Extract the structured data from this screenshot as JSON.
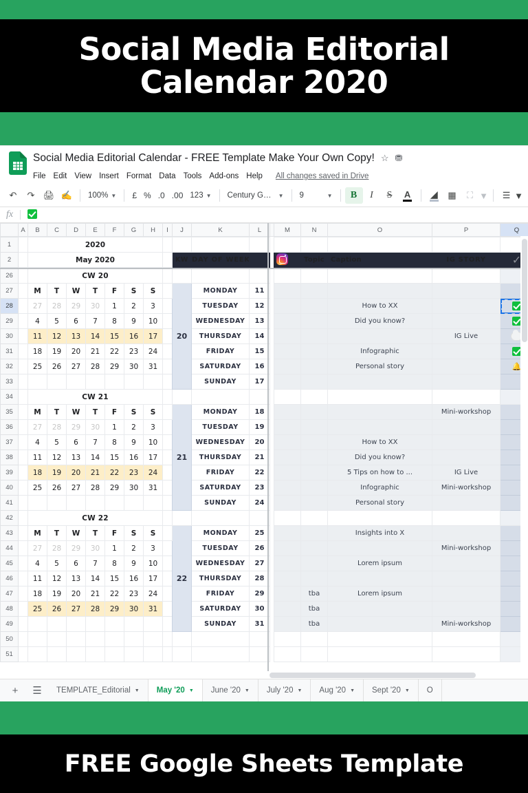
{
  "pin": {
    "top_title_line1": "Social Media Editorial",
    "top_title_line2": "Calendar 2020",
    "bottom_title": "FREE Google Sheets Template",
    "brand_green": "#28a35f",
    "banner_black": "#000000"
  },
  "app": {
    "doc_title": "Social Media Editorial Calendar - FREE Template Make Your Own Copy!",
    "star_icon": "star-icon",
    "drive_icon": "move-to-drive-icon",
    "menus": [
      "File",
      "Edit",
      "View",
      "Insert",
      "Format",
      "Data",
      "Tools",
      "Add-ons",
      "Help"
    ],
    "save_status": "All changes saved in Drive"
  },
  "toolbar": {
    "undo_icon": "undo-icon",
    "redo_icon": "redo-icon",
    "print_icon": "print-icon",
    "paint_format_icon": "paint-format-icon",
    "zoom_value": "100%",
    "currency_label": "£",
    "percent_label": "%",
    "dec_decrease_label": ".0",
    "dec_increase_label": ".00",
    "format_label": "123",
    "font_name": "Century Go...",
    "font_size": "9",
    "bold_label": "B",
    "italic_label": "I",
    "strike_label": "S",
    "text_color_label": "A",
    "fill_color_icon": "fill-color-icon",
    "borders_icon": "borders-icon",
    "merge_icon": "merge-cells-icon",
    "align_icon": "horizontal-align-icon"
  },
  "formula_bar": {
    "fx_label": "fx",
    "cell_value_icon": "green-check-emoji"
  },
  "grid": {
    "columns": [
      "A",
      "B",
      "C",
      "D",
      "E",
      "F",
      "G",
      "H",
      "I",
      "J",
      "K",
      "L",
      "M",
      "N",
      "O",
      "P",
      "Q"
    ],
    "selected_column": "Q",
    "row_numbers_top": [
      "1",
      "2"
    ],
    "row_numbers_body": [
      "26",
      "27",
      "28",
      "29",
      "30",
      "31",
      "32",
      "33",
      "34",
      "35",
      "36",
      "37",
      "38",
      "39",
      "40",
      "41",
      "42",
      "43",
      "44",
      "45",
      "46",
      "47",
      "48",
      "49",
      "50",
      "51"
    ],
    "selected_row": "28"
  },
  "left_panel": {
    "year_label": "2020",
    "month_label": "May 2020",
    "weekday_initials": [
      "M",
      "T",
      "W",
      "T",
      "F",
      "S",
      "S"
    ],
    "calendars": [
      {
        "cw_label": "CW 20",
        "highlight_row_index": 2,
        "weeks": [
          {
            "days": [
              "27",
              "28",
              "29",
              "30",
              "1",
              "2",
              "3"
            ],
            "dim": [
              true,
              true,
              true,
              true,
              false,
              false,
              false
            ]
          },
          {
            "days": [
              "4",
              "5",
              "6",
              "7",
              "8",
              "9",
              "10"
            ],
            "dim": [
              false,
              false,
              false,
              false,
              false,
              false,
              false
            ]
          },
          {
            "days": [
              "11",
              "12",
              "13",
              "14",
              "15",
              "16",
              "17"
            ],
            "dim": [
              false,
              false,
              false,
              false,
              false,
              false,
              false
            ]
          },
          {
            "days": [
              "18",
              "19",
              "20",
              "21",
              "22",
              "23",
              "24"
            ],
            "dim": [
              false,
              false,
              false,
              false,
              false,
              false,
              false
            ]
          },
          {
            "days": [
              "25",
              "26",
              "27",
              "28",
              "29",
              "30",
              "31"
            ],
            "dim": [
              false,
              false,
              false,
              false,
              false,
              false,
              false
            ]
          }
        ]
      },
      {
        "cw_label": "CW 21",
        "highlight_row_index": 3,
        "weeks": [
          {
            "days": [
              "27",
              "28",
              "29",
              "30",
              "1",
              "2",
              "3"
            ],
            "dim": [
              true,
              true,
              true,
              true,
              false,
              false,
              false
            ]
          },
          {
            "days": [
              "4",
              "5",
              "6",
              "7",
              "8",
              "9",
              "10"
            ],
            "dim": [
              false,
              false,
              false,
              false,
              false,
              false,
              false
            ]
          },
          {
            "days": [
              "11",
              "12",
              "13",
              "14",
              "15",
              "16",
              "17"
            ],
            "dim": [
              false,
              false,
              false,
              false,
              false,
              false,
              false
            ]
          },
          {
            "days": [
              "18",
              "19",
              "20",
              "21",
              "22",
              "23",
              "24"
            ],
            "dim": [
              false,
              false,
              false,
              false,
              false,
              false,
              false
            ]
          },
          {
            "days": [
              "25",
              "26",
              "27",
              "28",
              "29",
              "30",
              "31"
            ],
            "dim": [
              false,
              false,
              false,
              false,
              false,
              false,
              false
            ]
          }
        ]
      },
      {
        "cw_label": "CW 22",
        "highlight_row_index": 4,
        "weeks": [
          {
            "days": [
              "27",
              "28",
              "29",
              "30",
              "1",
              "2",
              "3"
            ],
            "dim": [
              true,
              true,
              true,
              true,
              false,
              false,
              false
            ]
          },
          {
            "days": [
              "4",
              "5",
              "6",
              "7",
              "8",
              "9",
              "10"
            ],
            "dim": [
              false,
              false,
              false,
              false,
              false,
              false,
              false
            ]
          },
          {
            "days": [
              "11",
              "12",
              "13",
              "14",
              "15",
              "16",
              "17"
            ],
            "dim": [
              false,
              false,
              false,
              false,
              false,
              false,
              false
            ]
          },
          {
            "days": [
              "18",
              "19",
              "20",
              "21",
              "22",
              "23",
              "24"
            ],
            "dim": [
              false,
              false,
              false,
              false,
              false,
              false,
              false
            ]
          },
          {
            "days": [
              "25",
              "26",
              "27",
              "28",
              "29",
              "30",
              "31"
            ],
            "dim": [
              false,
              false,
              false,
              false,
              false,
              false,
              false
            ]
          }
        ]
      }
    ]
  },
  "table_header": {
    "kw": "KW",
    "day_of_week": "DAY OF WEEK",
    "platform_icon": "instagram-icon",
    "topic": "Topic",
    "caption": "Caption",
    "ig_story": "IG STORY",
    "check_icon": "checkmark-icon"
  },
  "table_data": {
    "weeks": [
      {
        "kw": "20",
        "rows": [
          {
            "day": "MONDAY",
            "date": "11",
            "topic": "",
            "caption": "",
            "story": "",
            "status": ""
          },
          {
            "day": "TUESDAY",
            "date": "12",
            "topic": "",
            "caption": "How to XX",
            "story": "",
            "status": "check",
            "selected": true
          },
          {
            "day": "WEDNESDAY",
            "date": "13",
            "topic": "",
            "caption": "Did you know?",
            "story": "",
            "status": "check"
          },
          {
            "day": "THURSDAY",
            "date": "14",
            "topic": "",
            "caption": "",
            "story": "IG Live",
            "status": "cloud"
          },
          {
            "day": "FRIDAY",
            "date": "15",
            "topic": "",
            "caption": "Infographic",
            "story": "",
            "status": "check"
          },
          {
            "day": "SATURDAY",
            "date": "16",
            "topic": "",
            "caption": "Personal story",
            "story": "",
            "status": "bell"
          },
          {
            "day": "SUNDAY",
            "date": "17",
            "topic": "",
            "caption": "",
            "story": "",
            "status": ""
          }
        ]
      },
      {
        "kw": "21",
        "rows": [
          {
            "day": "MONDAY",
            "date": "18",
            "topic": "",
            "caption": "",
            "story": "Mini-workshop",
            "status": ""
          },
          {
            "day": "TUESDAY",
            "date": "19",
            "topic": "",
            "caption": "",
            "story": "",
            "status": ""
          },
          {
            "day": "WEDNESDAY",
            "date": "20",
            "topic": "",
            "caption": "How to XX",
            "story": "",
            "status": ""
          },
          {
            "day": "THURSDAY",
            "date": "21",
            "topic": "",
            "caption": "Did you know?",
            "story": "",
            "status": ""
          },
          {
            "day": "FRIDAY",
            "date": "22",
            "topic": "",
            "caption": "5 Tips on how to ...",
            "story": "IG Live",
            "status": ""
          },
          {
            "day": "SATURDAY",
            "date": "23",
            "topic": "",
            "caption": "Infographic",
            "story": "Mini-workshop",
            "status": ""
          },
          {
            "day": "SUNDAY",
            "date": "24",
            "topic": "",
            "caption": "Personal story",
            "story": "",
            "status": ""
          }
        ]
      },
      {
        "kw": "22",
        "rows": [
          {
            "day": "MONDAY",
            "date": "25",
            "topic": "",
            "caption": "Insights into X",
            "story": "",
            "status": ""
          },
          {
            "day": "TUESDAY",
            "date": "26",
            "topic": "",
            "caption": "",
            "story": "Mini-workshop",
            "status": ""
          },
          {
            "day": "WEDNESDAY",
            "date": "27",
            "topic": "",
            "caption": "Lorem ipsum",
            "story": "",
            "status": ""
          },
          {
            "day": "THURSDAY",
            "date": "28",
            "topic": "",
            "caption": "",
            "story": "",
            "status": ""
          },
          {
            "day": "FRIDAY",
            "date": "29",
            "topic": "tba",
            "caption": "Lorem ipsum",
            "story": "",
            "status": ""
          },
          {
            "day": "SATURDAY",
            "date": "30",
            "topic": "tba",
            "caption": "",
            "story": "",
            "status": ""
          },
          {
            "day": "SUNDAY",
            "date": "31",
            "topic": "tba",
            "caption": "",
            "story": "Mini-workshop",
            "status": ""
          }
        ]
      }
    ]
  },
  "sheet_tabs": {
    "add_icon": "add-sheet-icon",
    "all_sheets_icon": "all-sheets-icon",
    "tabs": [
      {
        "label": "TEMPLATE_Editorial",
        "active": false
      },
      {
        "label": "May '20",
        "active": true
      },
      {
        "label": "June '20",
        "active": false
      },
      {
        "label": "July '20",
        "active": false
      },
      {
        "label": "Aug '20",
        "active": false
      },
      {
        "label": "Sept '20",
        "active": false
      },
      {
        "label": "O",
        "active": false
      }
    ]
  }
}
